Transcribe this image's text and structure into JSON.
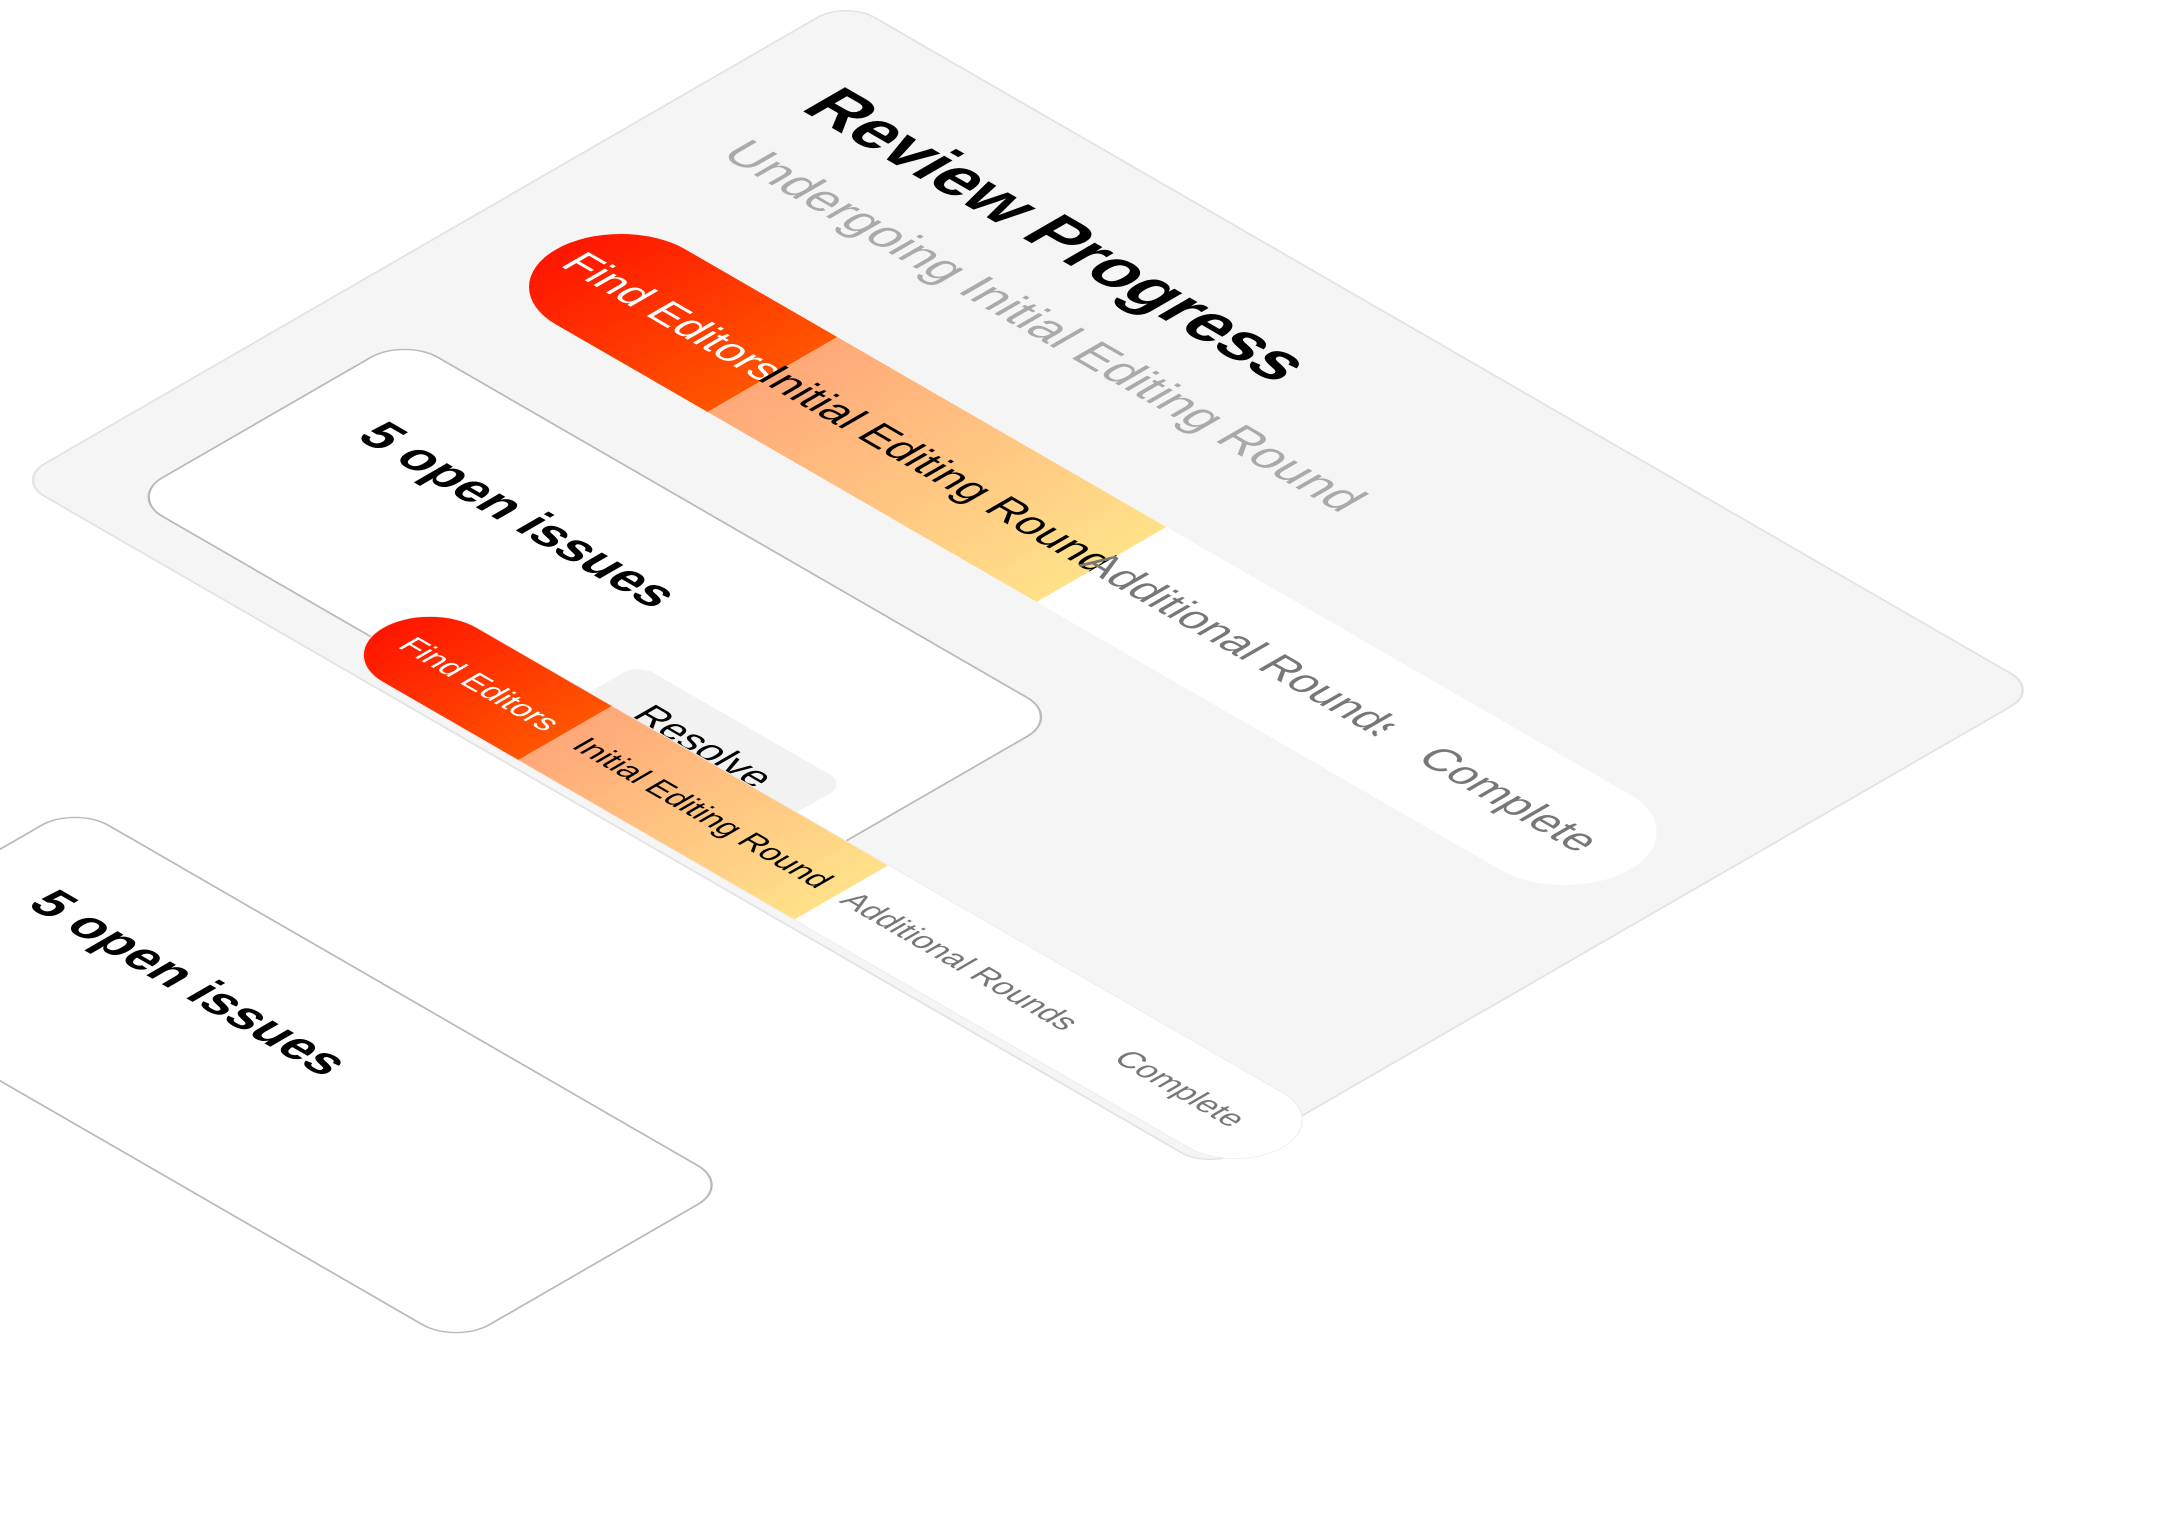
{
  "card": {
    "title": "Review Progress",
    "subtitle": "Undergoing Initial Editing Round"
  },
  "stages": [
    {
      "label": "Find Editors",
      "status": "done"
    },
    {
      "label": "Initial Editing Round",
      "status": "current"
    },
    {
      "label": "Additional Rounds",
      "status": "pending"
    },
    {
      "label": "Complete",
      "status": "pending"
    }
  ],
  "issues": {
    "count_label": "5 open issues",
    "resolve_label": "Resolve"
  },
  "colors": {
    "stage_done": "#ff3300",
    "stage_current_start": "#ffa879",
    "stage_current_end": "#ffe189",
    "card_background": "#f5f5f5",
    "subtitle": "#aaaaaa"
  }
}
